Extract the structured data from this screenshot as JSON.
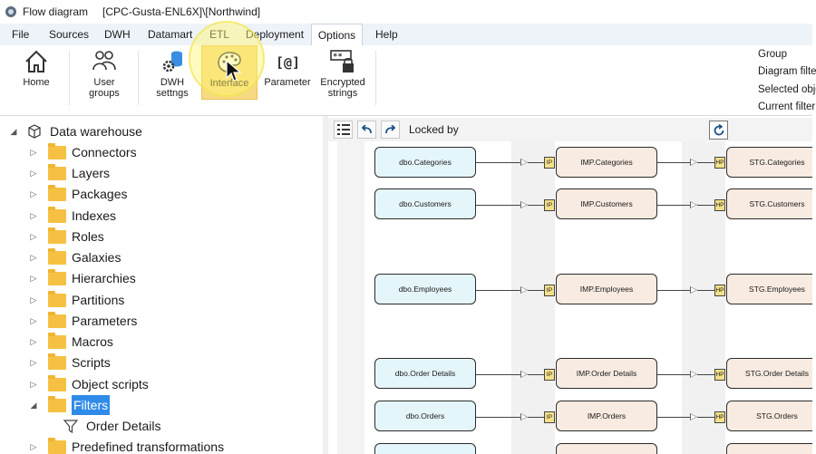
{
  "window": {
    "title": "Flow diagram",
    "subtitle": "[CPC-Gusta-ENL6X]\\[Northwind]"
  },
  "menu": {
    "tabs": [
      "File",
      "Sources",
      "DWH",
      "Datamart",
      "ETL",
      "Deployment",
      "Options",
      "Help"
    ],
    "active": "Options"
  },
  "ribbon": {
    "home": "Home",
    "user_groups_1": "User",
    "user_groups_2": "groups",
    "dwh_1": "DWH",
    "dwh_2": "settngs",
    "interface": "Interface",
    "parameter": "Parameter",
    "encrypted_1": "Encrypted",
    "encrypted_2": "strings",
    "right_items": [
      "Group",
      "Diagram filte",
      "Selected obje",
      "Current filter"
    ]
  },
  "tree": {
    "root": "Data warehouse",
    "items": [
      "Connectors",
      "Layers",
      "Packages",
      "Indexes",
      "Roles",
      "Galaxies",
      "Hierarchies",
      "Partitions",
      "Parameters",
      "Macros",
      "Scripts",
      "Object scripts",
      "Filters",
      "Order Details",
      "Predefined transformations"
    ]
  },
  "diagram": {
    "locked_by": "Locked by",
    "rows": [
      {
        "src": "dbo.Categories",
        "imp": "IMP.Categories",
        "stg": "STG.Categories"
      },
      {
        "src": "dbo.Customers",
        "imp": "IMP.Customers",
        "stg": "STG.Customers"
      },
      {
        "src": "dbo.Employees",
        "imp": "IMP.Employees",
        "stg": "STG.Employees"
      },
      {
        "src": "dbo.Order Details",
        "imp": "IMP.Order Details",
        "stg": "STG.Order Details"
      },
      {
        "src": "dbo.Orders",
        "imp": "IMP.Orders",
        "stg": "STG.Orders"
      }
    ],
    "tag_ip": "IP",
    "tag_hp": "HP"
  }
}
